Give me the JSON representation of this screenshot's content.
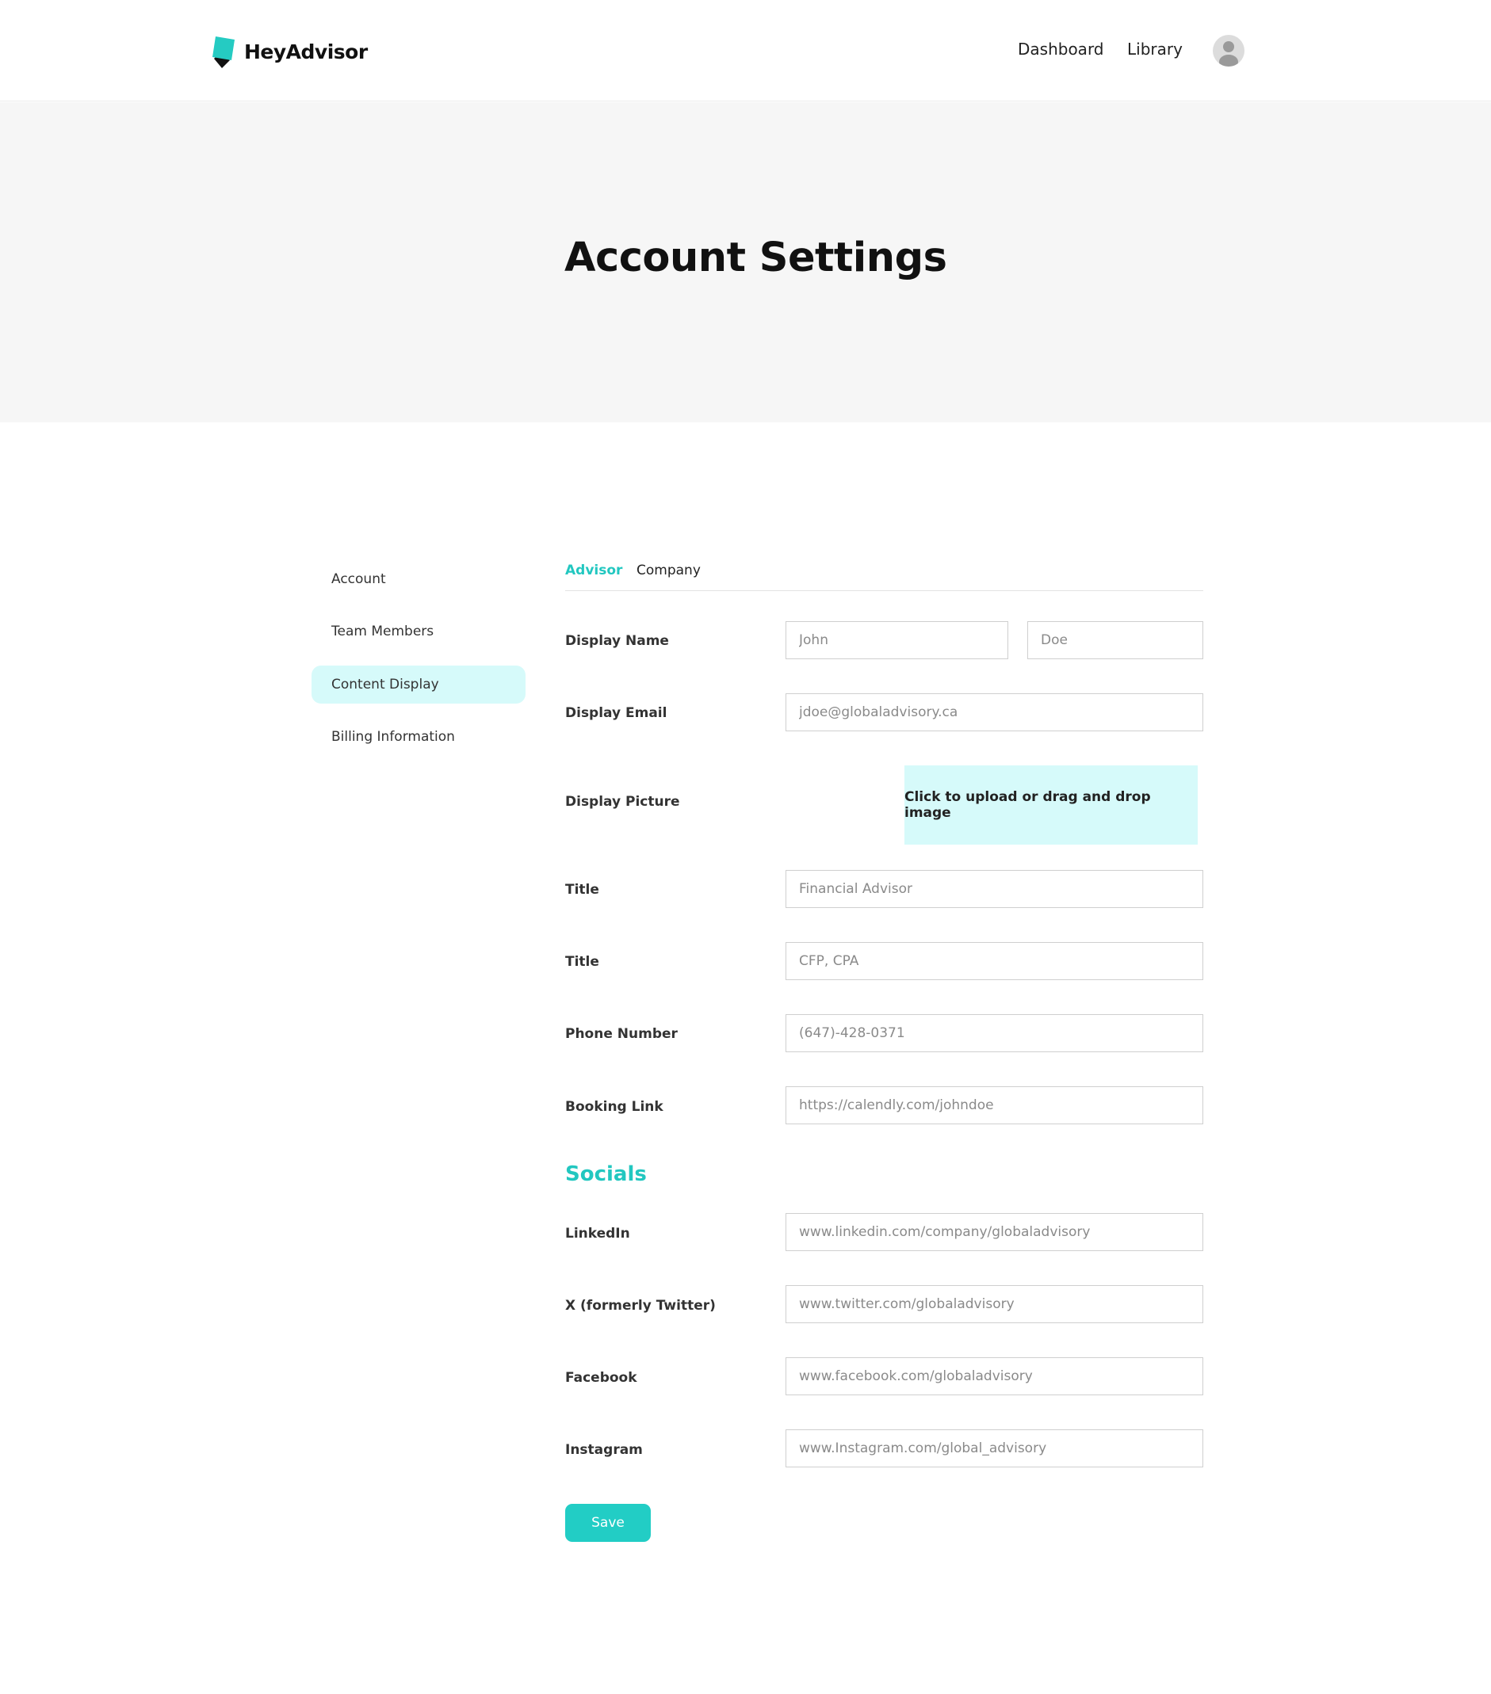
{
  "header": {
    "logo_text": "HeyAdvisor",
    "nav": {
      "dashboard": "Dashboard",
      "library": "Library"
    }
  },
  "hero": {
    "title": "Account Settings"
  },
  "sidebar": {
    "items": [
      {
        "label": "Account"
      },
      {
        "label": "Team Members"
      },
      {
        "label": "Content Display"
      },
      {
        "label": "Billing Information"
      }
    ],
    "active": "Content Display"
  },
  "tabs": {
    "advisor": "Advisor",
    "company": "Company",
    "active": "Advisor"
  },
  "form": {
    "display_name": {
      "label": "Display Name",
      "first_placeholder": "John",
      "last_placeholder": "Doe"
    },
    "display_email": {
      "label": "Display Email",
      "placeholder": "jdoe@globaladvisory.ca"
    },
    "display_picture": {
      "label": "Display Picture",
      "upload_text": "Click to upload or drag and drop image"
    },
    "title": {
      "label": "Title",
      "placeholder": "Financial Advisor"
    },
    "designations": {
      "label": "Title",
      "placeholder": "CFP, CPA"
    },
    "phone": {
      "label": "Phone Number",
      "placeholder": "(647)-428-0371"
    },
    "booking": {
      "label": "Booking Link",
      "placeholder": "https://calendly.com/johndoe"
    }
  },
  "socials": {
    "heading": "Socials",
    "linkedin": {
      "label": "LinkedIn",
      "placeholder": "www.linkedin.com/company/globaladvisory"
    },
    "twitter": {
      "label": "X (formerly Twitter)",
      "placeholder": "www.twitter.com/globaladvisory"
    },
    "facebook": {
      "label": "Facebook",
      "placeholder": "www.facebook.com/globaladvisory"
    },
    "instagram": {
      "label": "Instagram",
      "placeholder": "www.Instagram.com/global_advisory"
    }
  },
  "actions": {
    "save": "Save"
  },
  "colors": {
    "accent": "#22cdc5",
    "accent_light": "#d6fafa",
    "hero_bg": "#f6f6f6"
  }
}
